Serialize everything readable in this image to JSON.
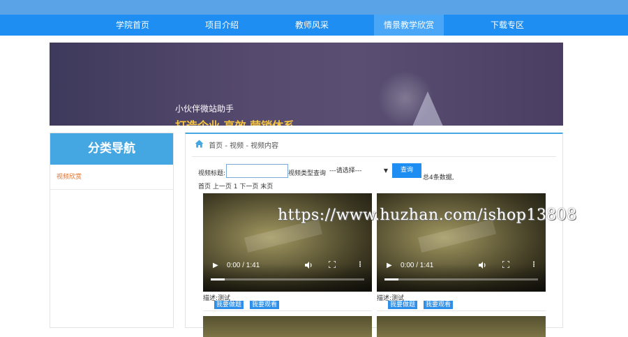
{
  "nav": {
    "items": [
      {
        "label": "学院首页",
        "active": false
      },
      {
        "label": "项目介绍",
        "active": false
      },
      {
        "label": "教师风采",
        "active": false
      },
      {
        "label": "情景教学欣赏",
        "active": true
      },
      {
        "label": "下载专区",
        "active": false
      }
    ]
  },
  "banner": {
    "title": "小伙伴微站助手",
    "subtitle": "打造企业 高效 营销体系"
  },
  "sidebar": {
    "heading": "分类导航",
    "items": [
      {
        "label": "视频欣赏"
      }
    ]
  },
  "breadcrumb": {
    "icon": "home-icon",
    "text": "首页 - 视频 - 视频内容"
  },
  "search": {
    "title_label": "视频标题:",
    "title_value": "",
    "type_label": "视频类型查询",
    "type_selected": "---请选择---",
    "button_label": "查询",
    "count_text": "总4条数据,"
  },
  "pager": {
    "first": "首页",
    "prev": "上一页",
    "current": "1",
    "next": "下一页",
    "last": "末页"
  },
  "videos": [
    {
      "time": "0:00 / 1:41",
      "progress": 0.09,
      "description": "描述:测试",
      "btn_practice": "我要做题",
      "btn_watch": "我要观看"
    },
    {
      "time": "0:00 / 1:41",
      "progress": 0.09,
      "description": "描述:测试",
      "btn_practice": "我要做题",
      "btn_watch": "我要观看"
    }
  ],
  "watermark": "https://www.huzhan.com/ishop13808",
  "colors": {
    "nav_bg": "#1e8ef2",
    "nav_active": "#4aa6f7",
    "sidebar_head": "#45a7e2",
    "sidebar_link": "#e0722c",
    "button": "#1e8ef2"
  }
}
